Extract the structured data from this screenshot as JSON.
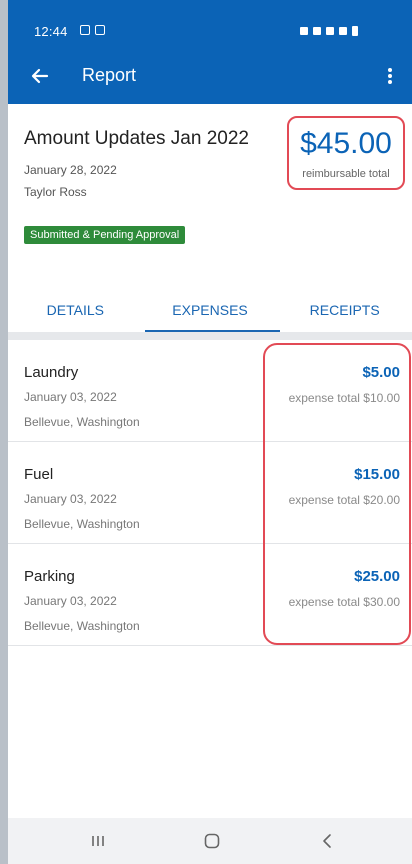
{
  "status_bar": {
    "time": "12:44"
  },
  "app_bar": {
    "title": "Report"
  },
  "report": {
    "title": "Amount Updates Jan 2022",
    "date": "January 28, 2022",
    "owner": "Taylor Ross",
    "total_amount": "$45.00",
    "total_caption": "reimbursable total",
    "status": "Submitted & Pending Approval"
  },
  "tabs": [
    {
      "label": "DETAILS"
    },
    {
      "label": "EXPENSES"
    },
    {
      "label": "RECEIPTS"
    }
  ],
  "selected_tab": "EXPENSES",
  "expenses": [
    {
      "name": "Laundry",
      "date": "January 03, 2022",
      "location": "Bellevue, Washington",
      "amount": "$5.00",
      "total": "expense total $10.00"
    },
    {
      "name": "Fuel",
      "date": "January 03, 2022",
      "location": "Bellevue, Washington",
      "amount": "$15.00",
      "total": "expense total $20.00"
    },
    {
      "name": "Parking",
      "date": "January 03, 2022",
      "location": "Bellevue, Washington",
      "amount": "$25.00",
      "total": "expense total $30.00"
    }
  ],
  "colors": {
    "brand_blue": "#0b63b6",
    "status_green": "#2e8b3a",
    "highlight_red": "#e24a55"
  },
  "icons": {
    "back": "arrow-left-icon",
    "menu": "more-vertical-icon",
    "nav_recents": "recents-icon",
    "nav_home": "home-icon",
    "nav_back": "chevron-left-icon"
  }
}
